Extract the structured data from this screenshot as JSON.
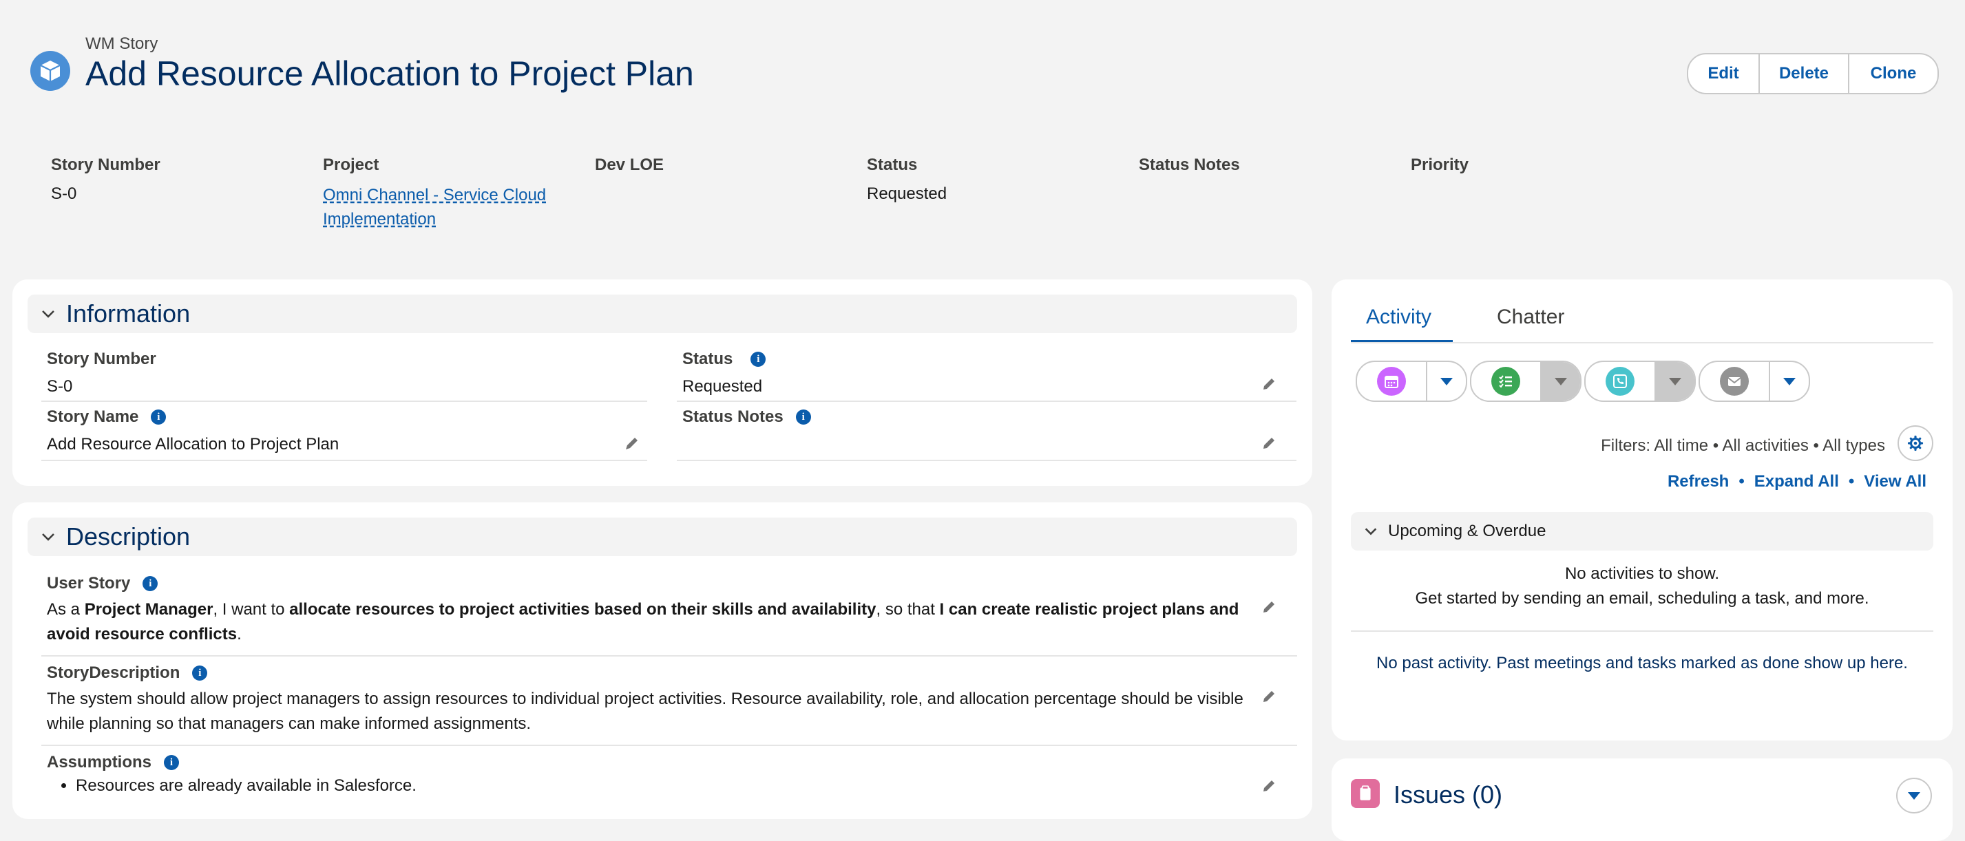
{
  "header": {
    "object_type": "WM Story",
    "title": "Add Resource Allocation to Project Plan",
    "buttons": {
      "edit": "Edit",
      "delete": "Delete",
      "clone": "Clone"
    }
  },
  "highlights": {
    "story_number": {
      "label": "Story Number",
      "value": "S-0"
    },
    "project": {
      "label": "Project",
      "value_line1": "Omni Channel - Service Cloud",
      "value_line2": "Implementation"
    },
    "dev_loe": {
      "label": "Dev LOE",
      "value": ""
    },
    "status": {
      "label": "Status",
      "value": "Requested"
    },
    "status_notes": {
      "label": "Status Notes",
      "value": ""
    },
    "priority": {
      "label": "Priority",
      "value": ""
    }
  },
  "information": {
    "title": "Information",
    "story_number": {
      "label": "Story Number",
      "value": "S-0"
    },
    "status": {
      "label": "Status",
      "value": "Requested"
    },
    "story_name": {
      "label": "Story Name",
      "value": "Add Resource Allocation to Project Plan"
    },
    "status_notes": {
      "label": "Status Notes",
      "value": ""
    }
  },
  "description": {
    "title": "Description",
    "user_story": {
      "label": "User Story",
      "t1": "As a ",
      "b1": "Project Manager",
      "t2": ", I want to ",
      "b2": "allocate resources to project activities based on their skills and availability",
      "t3": ", so that ",
      "b3": "I can create realistic project plans and avoid resource conflicts",
      "t4": "."
    },
    "story_description": {
      "label": "StoryDescription",
      "value": "The system should allow project managers to assign resources to individual project activities. Resource availability, role, and allocation percentage should be visible while planning so that managers can make informed assignments."
    },
    "assumptions": {
      "label": "Assumptions",
      "items": [
        "Resources are already available in Salesforce."
      ]
    }
  },
  "activity": {
    "tabs": [
      "Activity",
      "Chatter"
    ],
    "active_tab": "Activity",
    "filters_text": "Filters: All time • All activities • All types",
    "links": {
      "refresh": "Refresh",
      "expand_all": "Expand All",
      "view_all": "View All",
      "separator": "•"
    },
    "upcoming": {
      "label": "Upcoming & Overdue",
      "empty_line1": "No activities to show.",
      "empty_line2": "Get started by sending an email, scheduling a task, and more."
    },
    "past_empty": "No past activity. Past meetings and tasks marked as done show up here.",
    "action_icons": [
      "calendar-icon",
      "task-icon",
      "call-icon",
      "email-icon"
    ]
  },
  "related": {
    "issues_label": "Issues (0)"
  },
  "colors": {
    "brand_blue": "#0b5cab",
    "title_navy": "#032d60",
    "event_purple": "#cb65ff",
    "task_green": "#3ba755",
    "call_teal": "#48c3cc",
    "email_grey": "#939393",
    "issues_pink": "#e16d9c"
  }
}
